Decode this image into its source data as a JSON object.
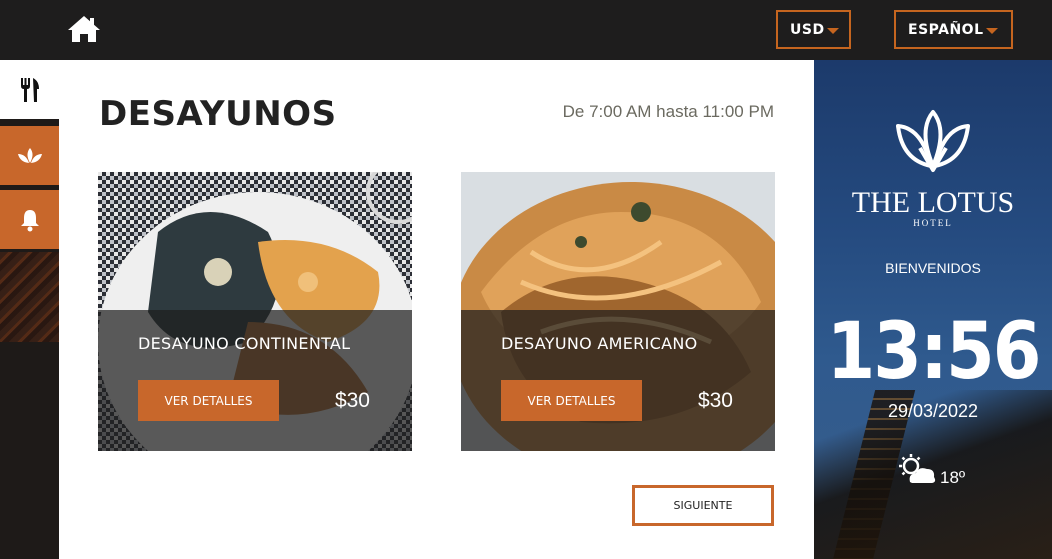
{
  "topbar": {
    "currency": "USD",
    "language": "ESPAÑOL"
  },
  "sidebar": {
    "items": [
      {
        "icon": "cutlery-icon",
        "active": true
      },
      {
        "icon": "lotus-icon",
        "active": false
      },
      {
        "icon": "bell-icon",
        "active": false
      }
    ]
  },
  "main": {
    "title": "DESAYUNOS",
    "schedule": "De 7:00 AM hasta 11:00 PM",
    "cards": [
      {
        "name": "DESAYUNO CONTINENTAL",
        "button": "VER DETALLES",
        "price": "$30"
      },
      {
        "name": "DESAYUNO AMERICANO",
        "button": "VER DETALLES",
        "price": "$30"
      }
    ],
    "next_button": "SIGUIENTE"
  },
  "hotel": {
    "brand": "THE LOTUS",
    "brand_sub": "HOTEL",
    "welcome": "BIENVENIDOS",
    "time": "13:56",
    "date": "29/03/2022",
    "temperature": "18º",
    "weather_icon": "partly-sunny-icon"
  },
  "colors": {
    "accent": "#c8672b",
    "topbar": "#1e1d1d",
    "panel": "#254b80"
  }
}
